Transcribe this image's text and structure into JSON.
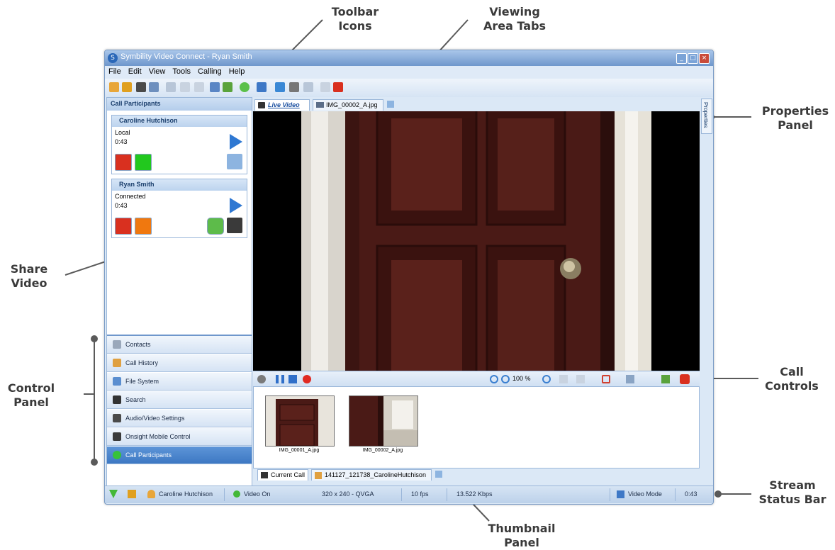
{
  "callouts": {
    "toolbar_icons": "Toolbar\nIcons",
    "viewing_area_tabs": "Viewing\nArea Tabs",
    "properties_panel": "Properties\nPanel",
    "share_video": "Share\nVideo",
    "call_controls": "Call\nControls",
    "control_panel": "Control\nPanel",
    "stream_status_bar": "Stream\nStatus Bar",
    "thumbnail_panel": "Thumbnail\nPanel"
  },
  "window": {
    "title": "Symbility Video Connect - Ryan Smith",
    "controls": [
      "_",
      "□",
      "×"
    ]
  },
  "menu": [
    "File",
    "Edit",
    "View",
    "Tools",
    "Calling",
    "Help"
  ],
  "side_panel": {
    "header": "Call Participants",
    "participants": [
      {
        "name": "Caroline Hutchison",
        "status": "Local",
        "time": "0:43"
      },
      {
        "name": "Ryan Smith",
        "status": "Connected",
        "time": "0:43"
      }
    ]
  },
  "nav_items": [
    {
      "label": "Contacts",
      "icon": "contacts-icon"
    },
    {
      "label": "Call History",
      "icon": "call-history-icon"
    },
    {
      "label": "File System",
      "icon": "file-system-icon"
    },
    {
      "label": "Search",
      "icon": "search-icon"
    },
    {
      "label": "Audio/Video Settings",
      "icon": "av-settings-icon"
    },
    {
      "label": "Onsight Mobile Control",
      "icon": "camera-icon"
    },
    {
      "label": "Call Participants",
      "icon": "call-participants-icon",
      "active": true
    }
  ],
  "view_tabs": [
    {
      "label": "Live Video",
      "active": true
    },
    {
      "label": "IMG_00002_A.jpg",
      "active": false
    }
  ],
  "properties_tab": "Properties",
  "video_controls": {
    "zoom": "100 %"
  },
  "thumbnails": [
    {
      "caption": "IMG_00001_A.jpg"
    },
    {
      "caption": "IMG_00002_A.jpg"
    }
  ],
  "thumb_tabs": [
    {
      "label": "Current Call",
      "active": true
    },
    {
      "label": "141127_121738_CarolineHutchison",
      "active": false
    }
  ],
  "status_bar": {
    "user": "Caroline Hutchison",
    "video": "Video On",
    "resolution": "320 x 240  -  QVGA",
    "fps": "10 fps",
    "bitrate": "13.522 Kbps",
    "mode": "Video Mode",
    "time": "0:43"
  },
  "colors": {
    "accent_blue": "#3d78c3",
    "end_call_red": "#d9301f",
    "green": "#22c81e",
    "orange": "#f0780f"
  }
}
